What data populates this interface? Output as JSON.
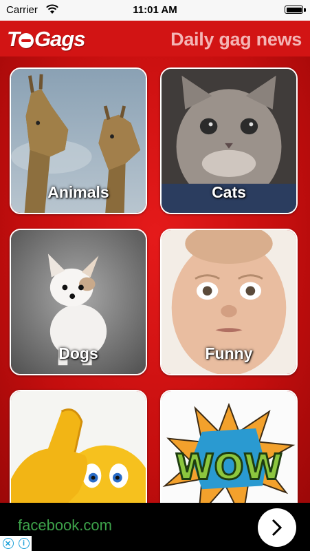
{
  "status_bar": {
    "carrier": "Carrier",
    "time": "11:01 AM"
  },
  "header": {
    "logo_prefix": "T",
    "logo_suffix": "Gags",
    "tagline": "Daily gag news"
  },
  "categories": [
    {
      "label": "Animals",
      "icon": "giraffes-image"
    },
    {
      "label": "Cats",
      "icon": "kitten-image"
    },
    {
      "label": "Dogs",
      "icon": "puppy-image"
    },
    {
      "label": "Funny",
      "icon": "funny-face-image"
    },
    {
      "label": "",
      "icon": "thumbs-up-emoji-image"
    },
    {
      "label": "",
      "icon": "wow-comic-image"
    }
  ],
  "ad": {
    "text": "facebook.com",
    "arrow_icon": "chevron-right-icon",
    "info_icons": [
      "close-x-icon",
      "info-icon"
    ]
  },
  "colors": {
    "header_red": "#d21414",
    "background_red": "#c40d0d",
    "tagline": "#f4b4b4",
    "ad_text": "#3da24a"
  }
}
